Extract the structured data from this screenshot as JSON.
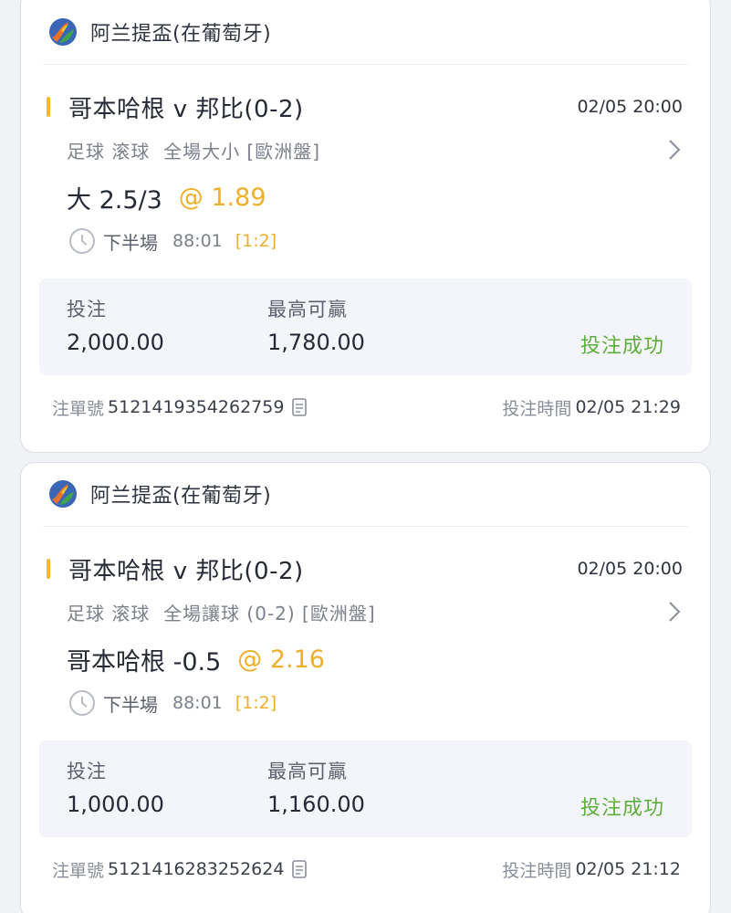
{
  "colors": {
    "accent": "#f5b82e",
    "odds": "#f0ae2a",
    "success": "#5fae3c"
  },
  "icons": {
    "logo": "league-logo-icon",
    "chevron": "chevron-right-icon",
    "clock": "clock-icon",
    "copy": "copy-icon"
  },
  "bets": [
    {
      "league": "阿兰提盃(在葡萄牙)",
      "match": "哥本哈根 v 邦比(0-2)",
      "kickoff": "02/05 20:00",
      "market": "足球 滚球  全場大小 [歐洲盤]",
      "selection": "大 2.5/3",
      "odds": "@ 1.89",
      "period": "下半場",
      "minute": "88:01",
      "score": "[1:2]",
      "stake_label": "投注",
      "stake": "2,000.00",
      "win_label": "最高可贏",
      "max_win": "1,780.00",
      "status": "投注成功",
      "ticket_label": "注單號",
      "ticket_no": "5121419354262759",
      "bet_time_label": "投注時間",
      "bet_time": "02/05 21:29"
    },
    {
      "league": "阿兰提盃(在葡萄牙)",
      "match": "哥本哈根 v 邦比(0-2)",
      "kickoff": "02/05 20:00",
      "market": "足球 滚球  全場讓球 (0-2) [歐洲盤]",
      "selection": "哥本哈根 -0.5",
      "odds": "@ 2.16",
      "period": "下半場",
      "minute": "88:01",
      "score": "[1:2]",
      "stake_label": "投注",
      "stake": "1,000.00",
      "win_label": "最高可贏",
      "max_win": "1,160.00",
      "status": "投注成功",
      "ticket_label": "注單號",
      "ticket_no": "5121416283252624",
      "bet_time_label": "投注時間",
      "bet_time": "02/05 21:12"
    }
  ]
}
